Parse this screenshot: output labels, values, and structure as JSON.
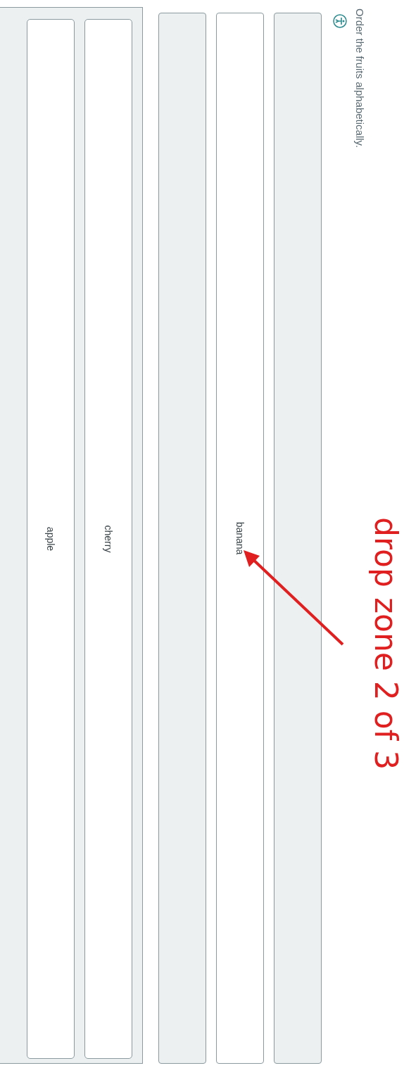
{
  "prompt": "Order the fruits alphabetically.",
  "drop_zones": [
    {
      "filled": false
    },
    {
      "filled": true,
      "item": "banana"
    },
    {
      "filled": false
    }
  ],
  "source_items": [
    "cherry",
    "apple"
  ],
  "annotation": {
    "text": "drop zone 2 of 3"
  }
}
